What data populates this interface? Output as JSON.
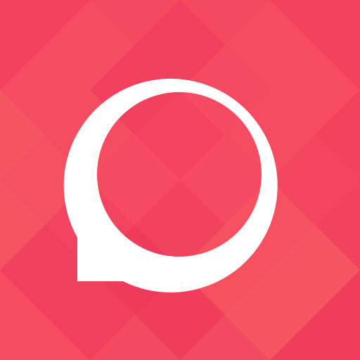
{
  "icon": {
    "name": "chat-bubble-logo",
    "background_color": "#f44a61",
    "background_pattern_colors": [
      "#f2415e",
      "#f64e63",
      "#ef3e5f",
      "#f75860",
      "#ee3a59"
    ],
    "glyph_color": "#ffffff"
  }
}
